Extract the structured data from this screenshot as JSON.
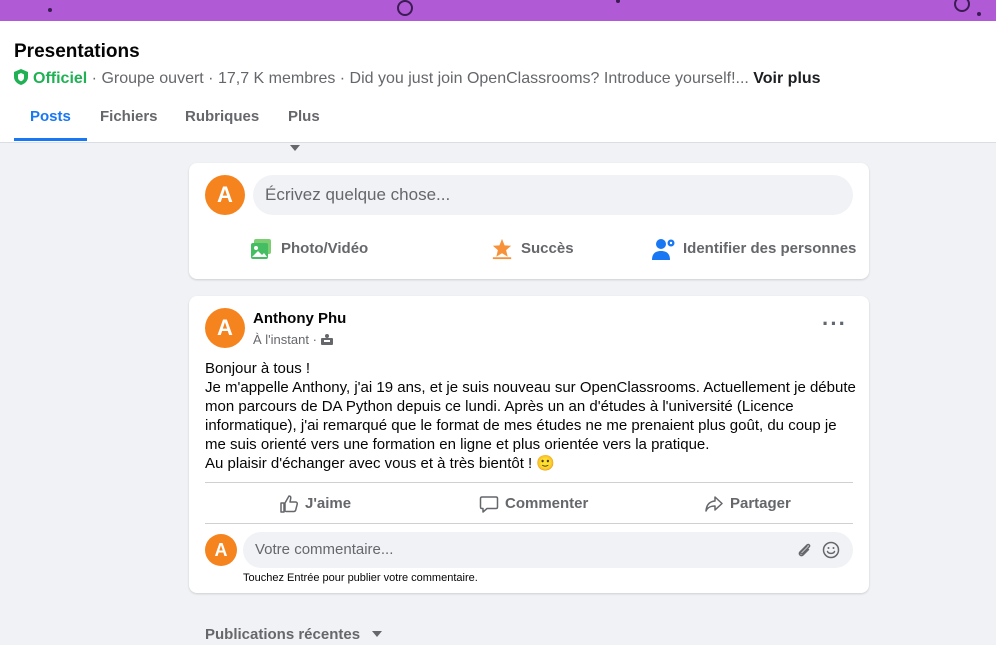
{
  "colors": {
    "accent": "#1877f2",
    "official": "#1fb154",
    "banner": "#b05ad6",
    "avatar": "#f5841f"
  },
  "group": {
    "title": "Presentations",
    "official_label": "Officiel",
    "meta_text": " · Groupe ouvert · 17,7 K membres · Did you just join OpenClassrooms? Introduce yourself!... ",
    "see_more": "Voir plus"
  },
  "tabs": [
    {
      "label": "Posts",
      "active": true
    },
    {
      "label": "Fichiers",
      "active": false
    },
    {
      "label": "Rubriques",
      "active": false
    },
    {
      "label": "Plus",
      "active": false
    }
  ],
  "composer": {
    "avatar_letter": "A",
    "placeholder": "Écrivez quelque chose...",
    "actions": [
      {
        "label": "Photo/Vidéo",
        "icon": "photo-video-icon"
      },
      {
        "label": "Succès",
        "icon": "star-icon"
      },
      {
        "label": "Identifier des personnes",
        "icon": "tag-people-icon"
      }
    ]
  },
  "post": {
    "avatar_letter": "A",
    "author": "Anthony Phu",
    "time": "À l'instant · ",
    "text": "Bonjour à tous !\nJe m'appelle Anthony, j'ai 19 ans, et je suis nouveau sur OpenClassrooms. Actuellement je débute mon parcours de DA Python depuis ce lundi. Après un an d'études à l'université (Licence informatique), j'ai remarqué que le format de mes études ne me prenaient plus goût, du coup je me suis orienté vers une formation en ligne et plus orientée vers la pratique.\nAu plaisir d'échanger avec vous et à très bientôt ! 🙂",
    "actions": [
      {
        "label": "J'aime",
        "icon": "thumbs-up-icon"
      },
      {
        "label": "Commenter",
        "icon": "comment-icon"
      },
      {
        "label": "Partager",
        "icon": "share-icon"
      }
    ],
    "comment_avatar_letter": "A",
    "comment_placeholder": "Votre commentaire...",
    "comment_hint": "Touchez Entrée pour publier votre commentaire."
  },
  "recent_label": "Publications récentes"
}
